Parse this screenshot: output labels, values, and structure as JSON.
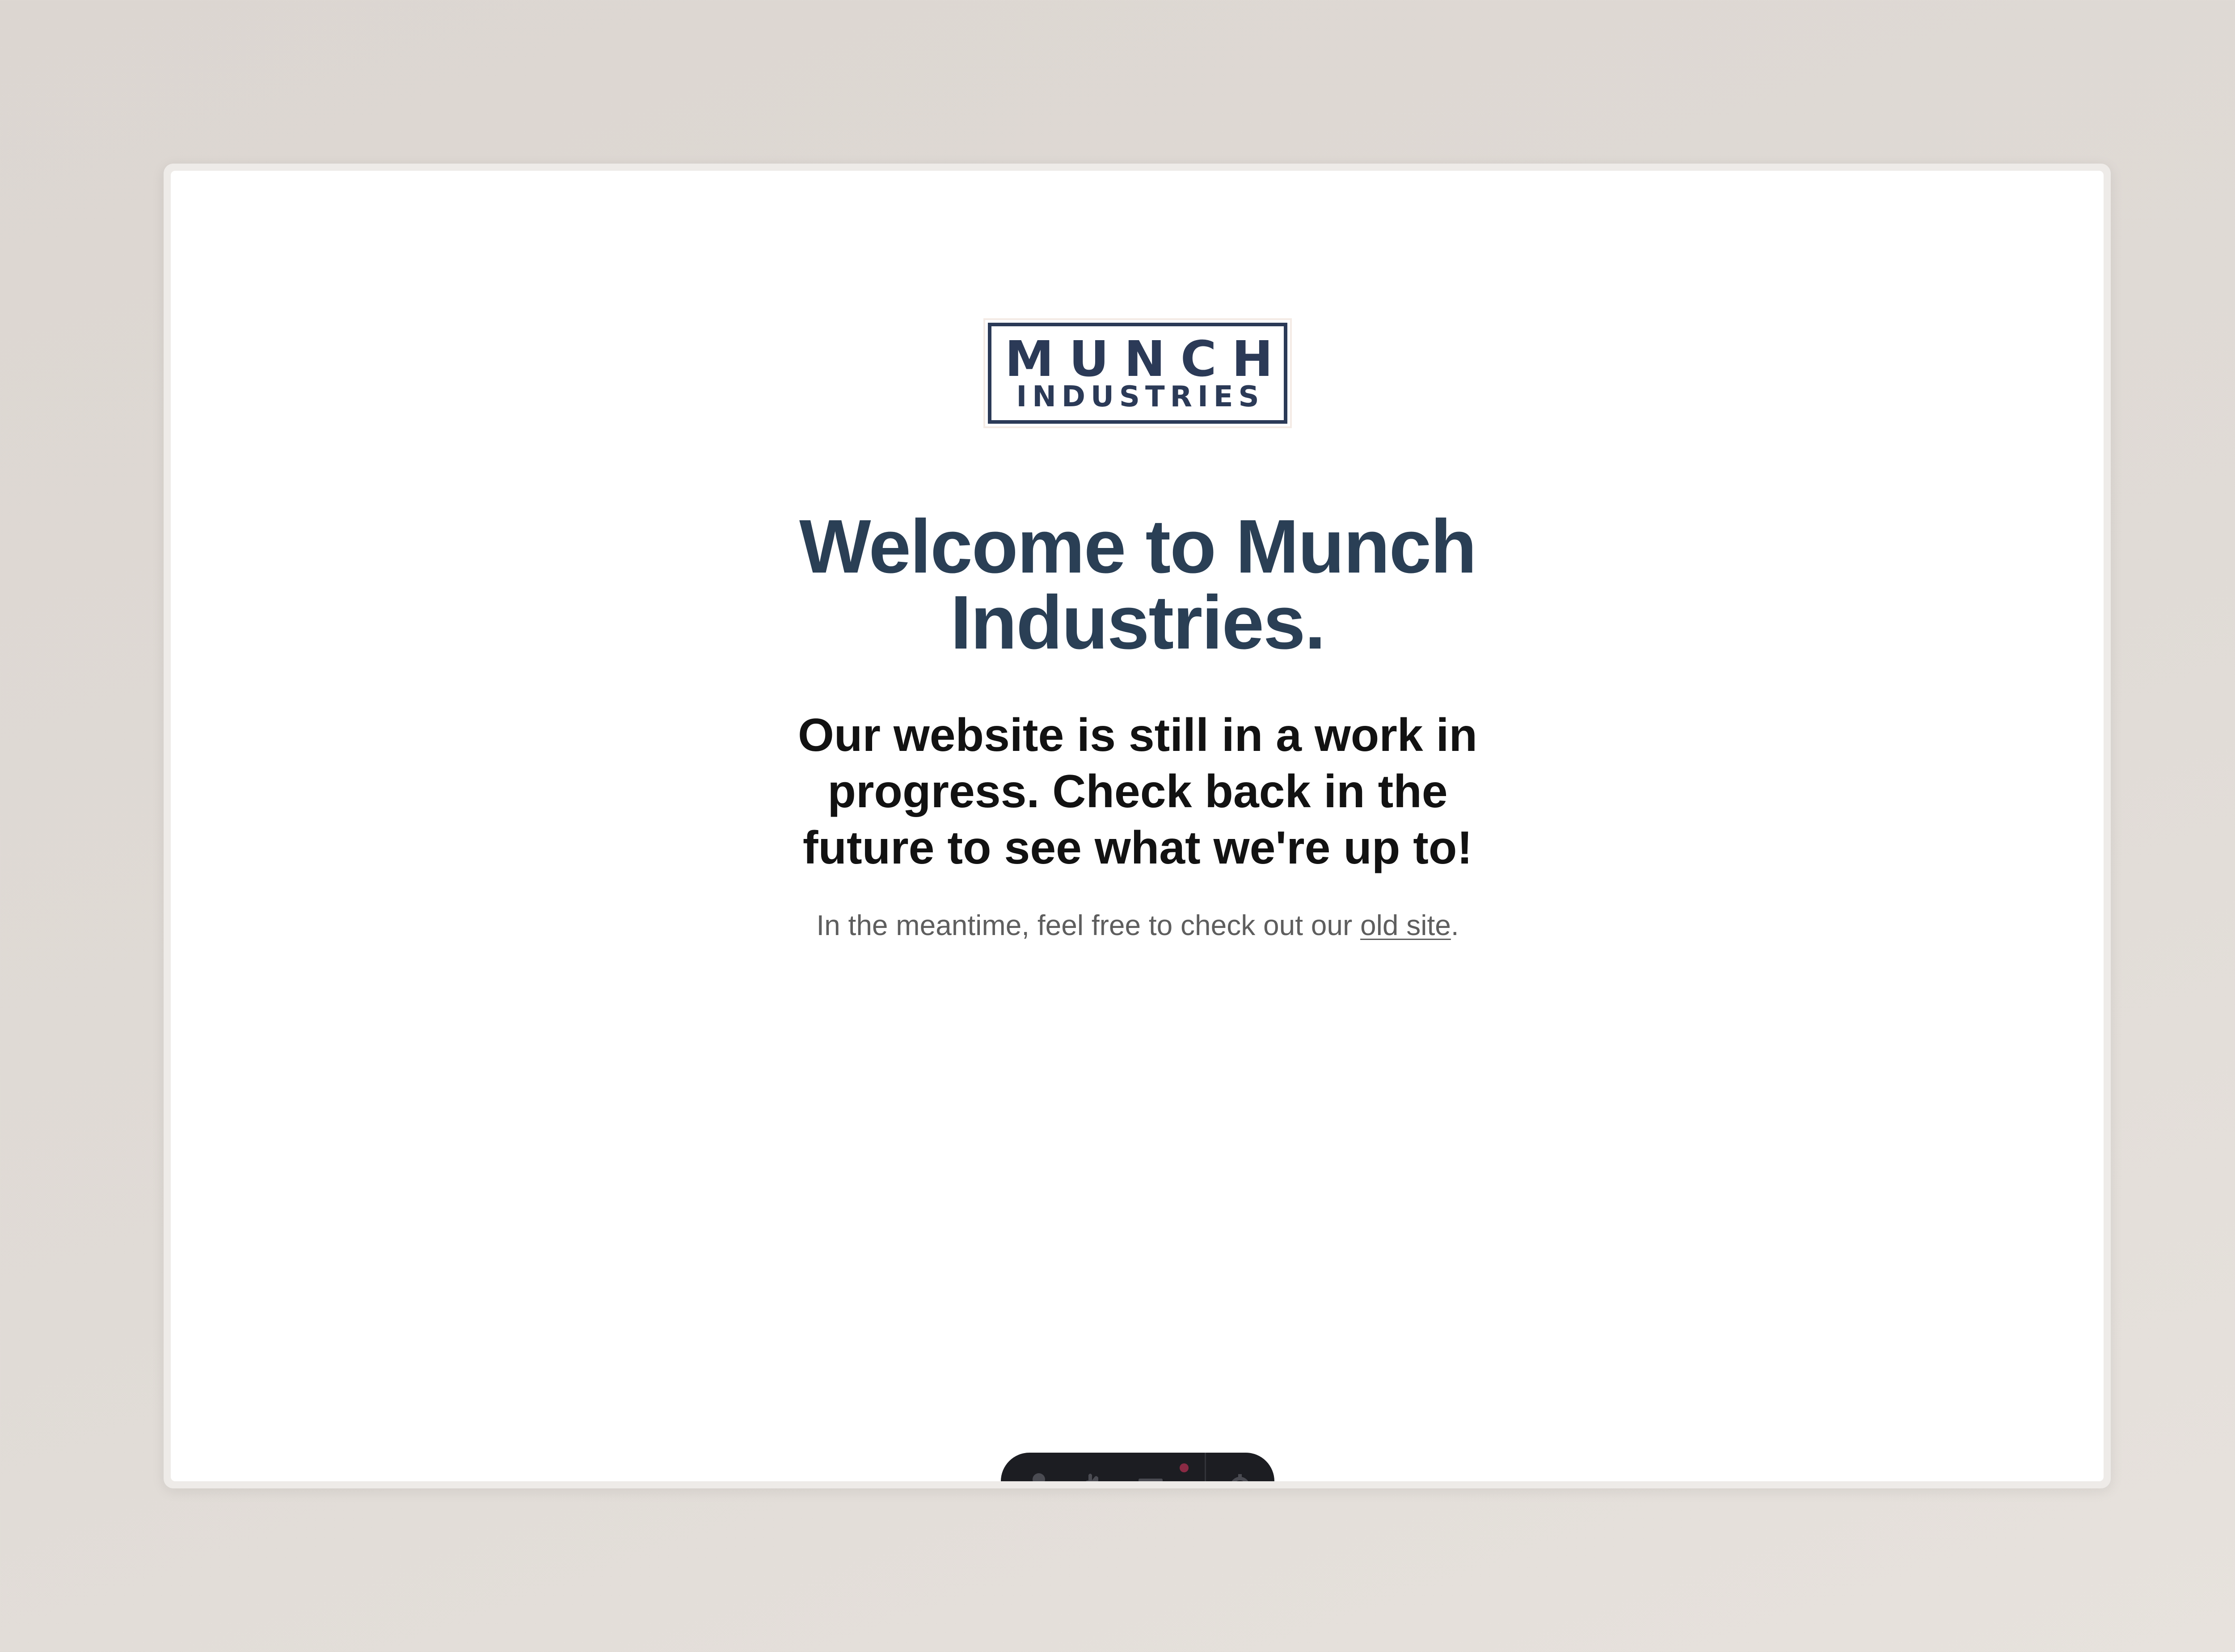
{
  "logo": {
    "line1": "MUNCH",
    "line2": "INDUSTRIES"
  },
  "hero": {
    "title": "Welcome to Munch Industries.",
    "subtitle": "Our website is still in a work in progress. Check back in the future to see what we're up to!",
    "note_prefix": "In the meantime, feel free to check out our ",
    "note_link": "old site",
    "note_suffix": "."
  },
  "dock": {
    "icons": [
      "person-icon",
      "hand-icon",
      "menu-icon",
      "gear-icon"
    ],
    "notification_color": "#8a2a44"
  },
  "colors": {
    "brand_navy": "#2b3a57",
    "title": "#2a3f55",
    "background": "#dedad5"
  }
}
